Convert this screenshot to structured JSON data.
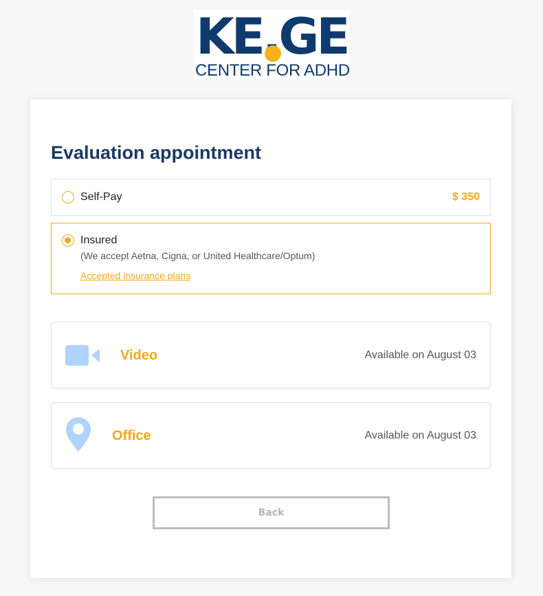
{
  "logo": {
    "main": "KE.GE",
    "sub": "CENTER FOR ADHD"
  },
  "card": {
    "title": "Evaluation appointment",
    "payment_options": [
      {
        "label": "Self-Pay",
        "price": "$ 350",
        "selected": false
      },
      {
        "label": "Insured",
        "note": "(We accept Aetna, Cigna, or United Healthcare/Optum)",
        "link": "Accepted insurance plans",
        "selected": true
      }
    ],
    "locations": [
      {
        "name": "Video",
        "availability": "Available on August 03",
        "icon": "video-camera-icon"
      },
      {
        "name": "Office",
        "availability": "Available on August 03",
        "icon": "location-pin-icon"
      }
    ],
    "back_label": "Back"
  },
  "colors": {
    "accent": "#f2a81d",
    "brand_navy": "#0f3a6e",
    "title": "#1a3a63",
    "icon_blue": "#aed4fb"
  }
}
